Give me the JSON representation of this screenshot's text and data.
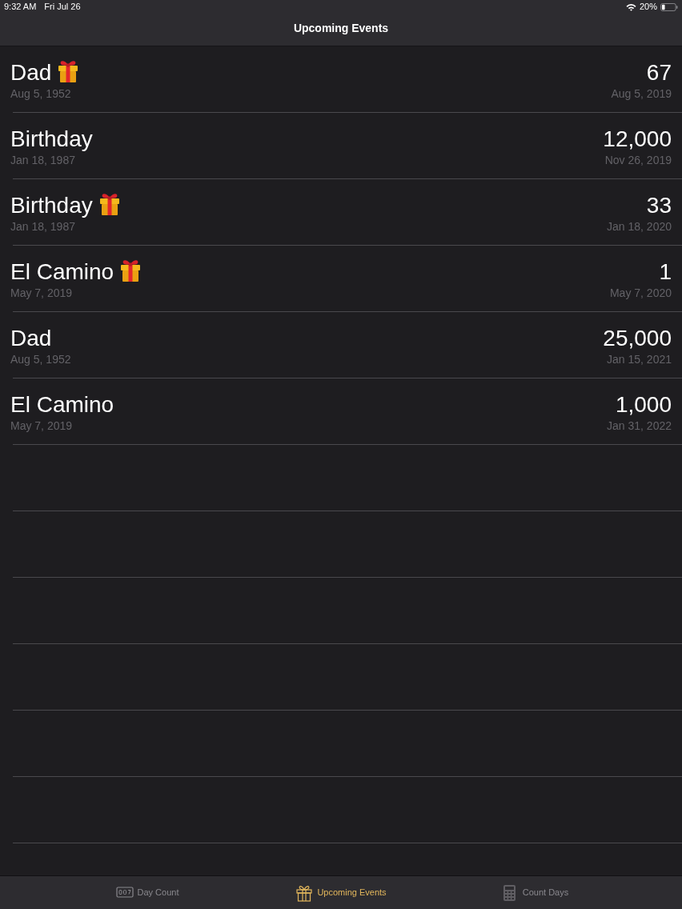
{
  "status_bar": {
    "time": "9:32 AM",
    "date": "Fri Jul 26",
    "battery": "20%"
  },
  "nav_bar": {
    "title": "Upcoming Events"
  },
  "events": [
    {
      "name": "Dad",
      "gift": true,
      "start_date": "Aug 5, 1952",
      "count": "67",
      "target_date": "Aug 5, 2019"
    },
    {
      "name": "Birthday",
      "gift": false,
      "start_date": "Jan 18, 1987",
      "count": "12,000",
      "target_date": "Nov 26, 2019"
    },
    {
      "name": "Birthday",
      "gift": true,
      "start_date": "Jan 18, 1987",
      "count": "33",
      "target_date": "Jan 18, 2020"
    },
    {
      "name": "El Camino",
      "gift": true,
      "start_date": "May 7, 2019",
      "count": "1",
      "target_date": "May 7, 2020"
    },
    {
      "name": "Dad",
      "gift": false,
      "start_date": "Aug 5, 1952",
      "count": "25,000",
      "target_date": "Jan 15, 2021"
    },
    {
      "name": "El Camino",
      "gift": false,
      "start_date": "May 7, 2019",
      "count": "1,000",
      "target_date": "Jan 31, 2022"
    }
  ],
  "tab_bar": {
    "tabs": [
      {
        "kind": "counter",
        "label": "Day Count",
        "selected": false
      },
      {
        "kind": "gift",
        "label": "Upcoming Events",
        "selected": true
      },
      {
        "kind": "calculator",
        "label": "Count Days",
        "selected": false
      }
    ]
  }
}
